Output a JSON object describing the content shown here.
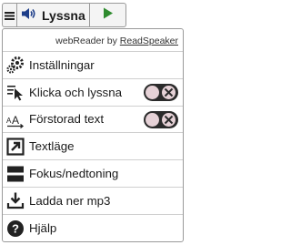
{
  "toolbar": {
    "listen_label": "Lyssna"
  },
  "panel": {
    "credit_prefix": "webReader by",
    "credit_brand": "ReadSpeaker",
    "items": [
      {
        "label": "Inställningar",
        "icon": "gears-icon"
      },
      {
        "label": "Klicka och lyssna",
        "icon": "click-listen-icon",
        "toggle": "off"
      },
      {
        "label": "Förstorad text",
        "icon": "enlarged-text-icon",
        "toggle": "off"
      },
      {
        "label": "Textläge",
        "icon": "text-mode-icon"
      },
      {
        "label": "Fokus/nedtoning",
        "icon": "focus-dimming-icon"
      },
      {
        "label": "Ladda ner mp3",
        "icon": "download-icon"
      },
      {
        "label": "Hjälp",
        "icon": "help-icon"
      }
    ]
  },
  "colors": {
    "play_green": "#2e8b2e",
    "toggle_dark": "#2b2b2b",
    "toggle_knob": "#e6d2d7"
  }
}
